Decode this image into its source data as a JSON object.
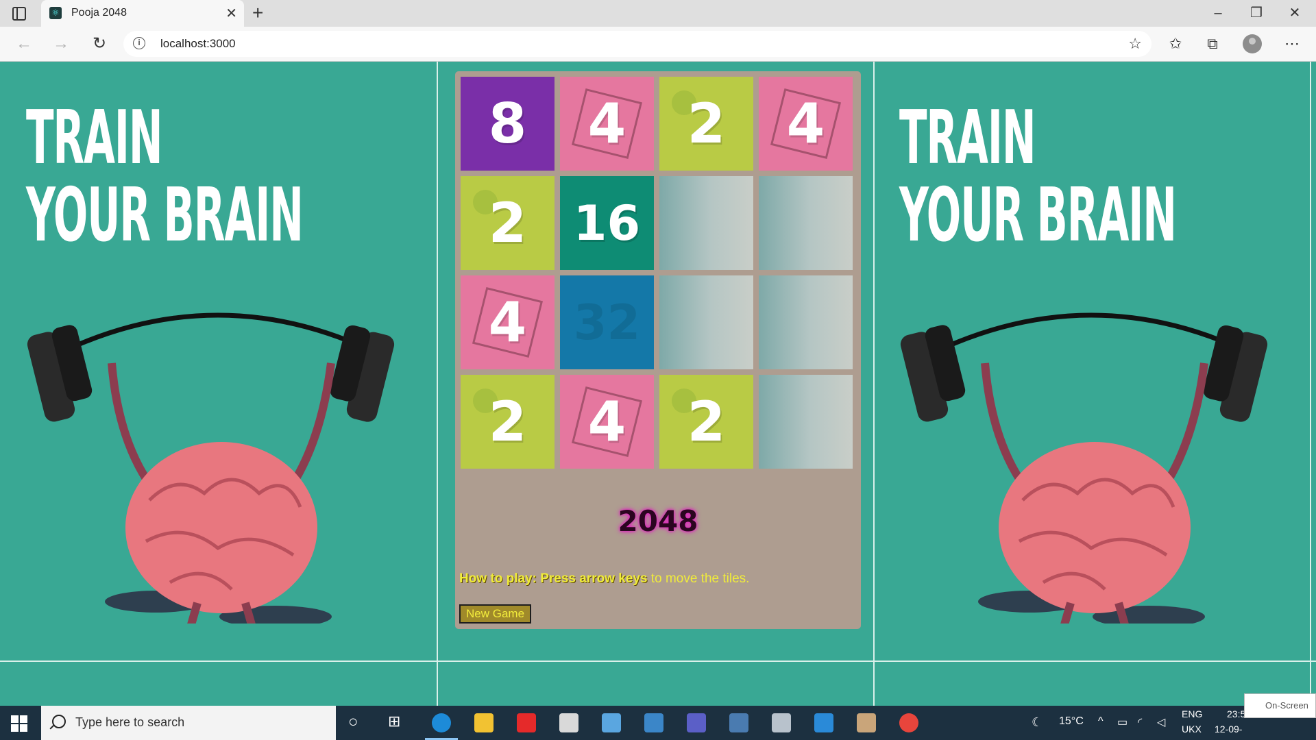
{
  "browser": {
    "tab_title": "Pooja 2048",
    "url": "localhost:3000"
  },
  "poster": {
    "line1": "TRAIN",
    "line2": "YOUR BRAIN"
  },
  "game": {
    "title": "2048",
    "instructions_bold": "How to play: Press arrow keys",
    "instructions_rest": " to move the tiles.",
    "new_game_label": "New Game",
    "board": [
      [
        8,
        4,
        2,
        4
      ],
      [
        2,
        16,
        0,
        0
      ],
      [
        4,
        32,
        0,
        0
      ],
      [
        2,
        4,
        2,
        0
      ]
    ]
  },
  "taskbar": {
    "search_placeholder": "Type here to search",
    "weather": "15°C",
    "lang_top": "ENG",
    "lang_bottom": "UKX",
    "time": "23:5",
    "date": "12-09-",
    "onscreen_label": "On-Screen"
  },
  "colors": {
    "page_bg": "#39a894",
    "board_bg": "#ae9d90",
    "accent_yellow": "#f0ec3a"
  }
}
